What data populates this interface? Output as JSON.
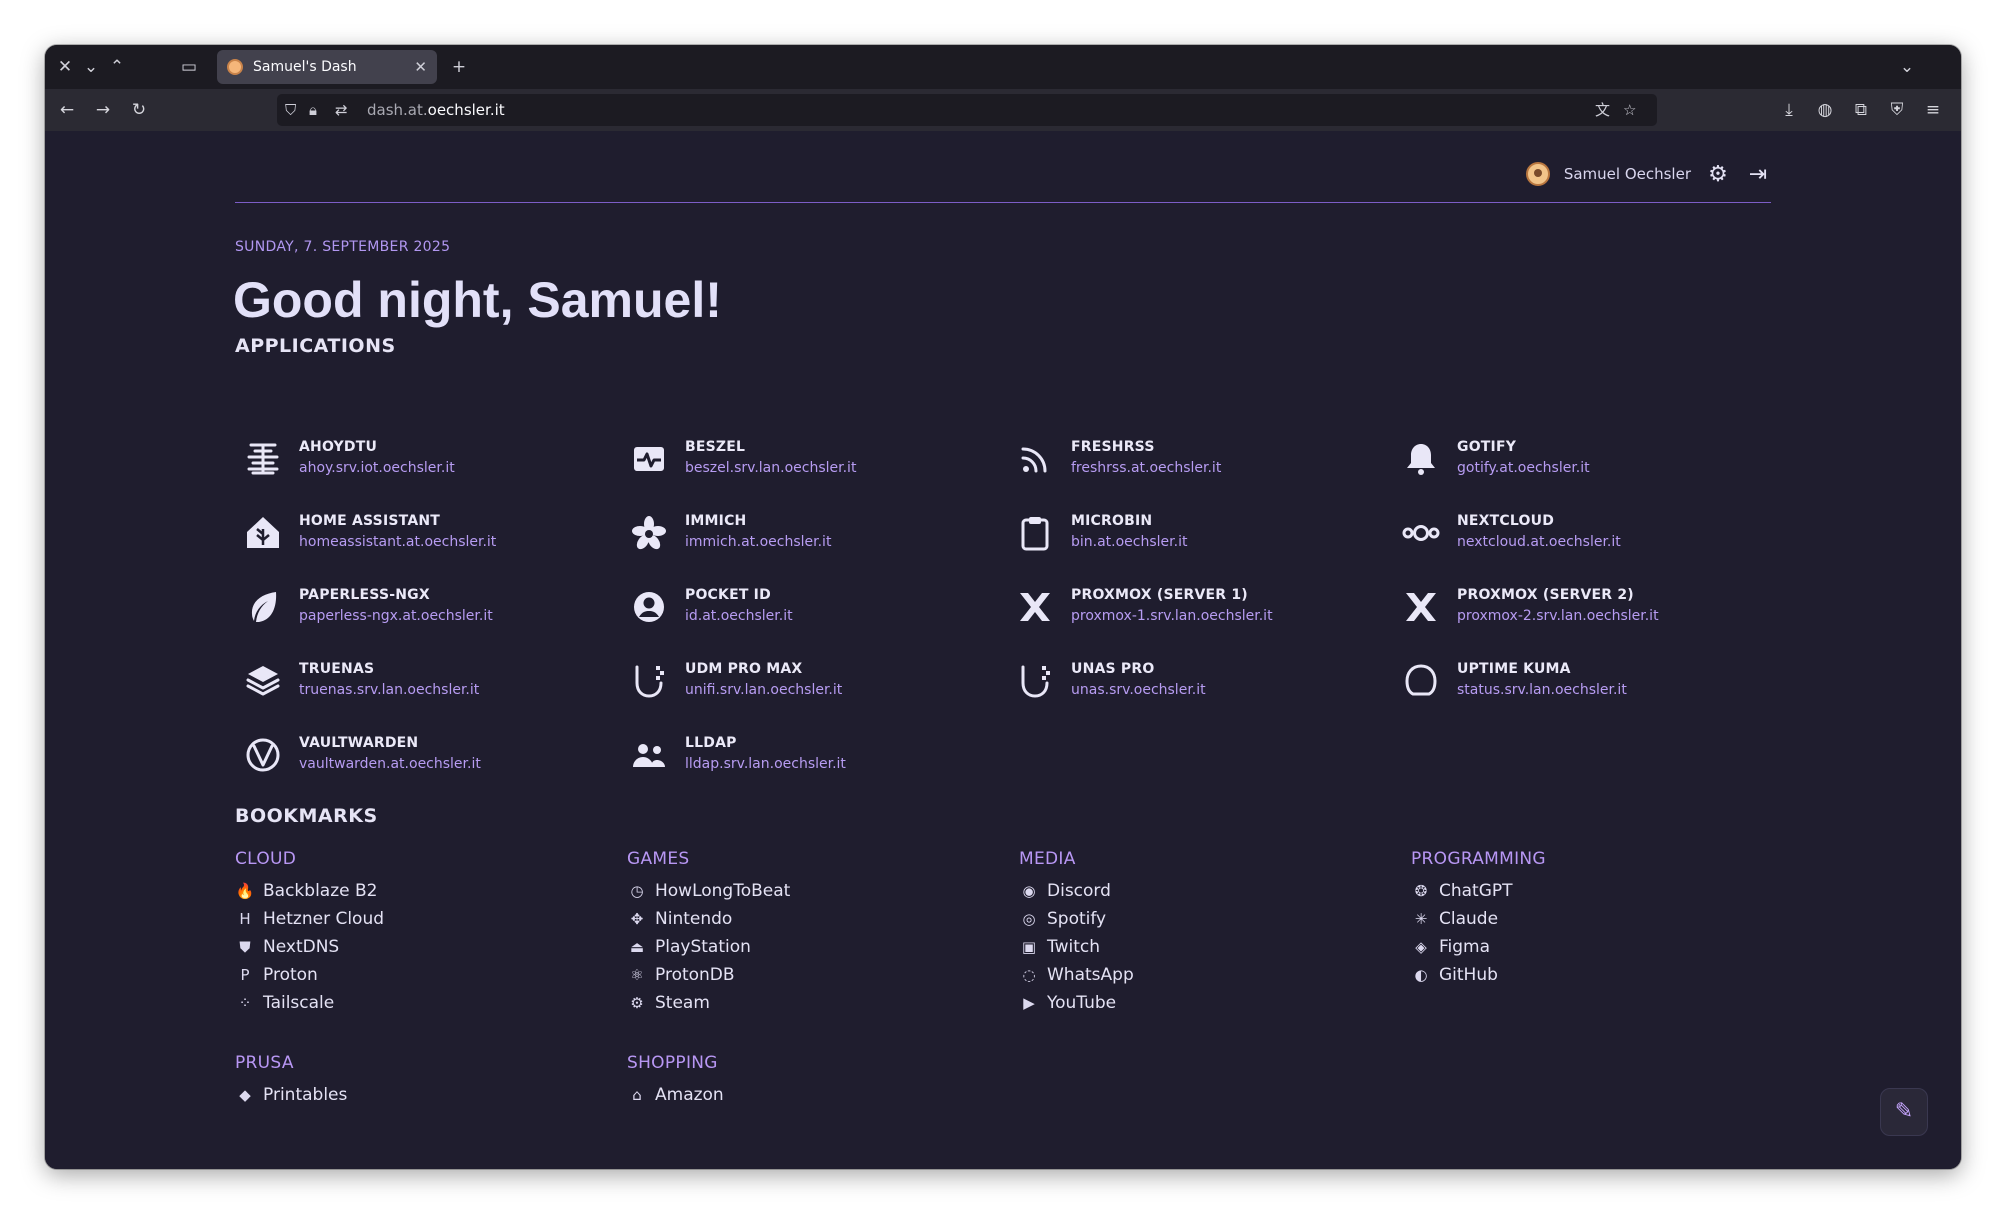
{
  "browser": {
    "tab_title": "Samuel's Dash",
    "new_tab": "+",
    "url_domain_prefix": "dash.at.",
    "url_domain_main": "oechsler.it"
  },
  "header": {
    "user_name": "Samuel Oechsler"
  },
  "greeting": {
    "date": "SUNDAY, 7. SEPTEMBER 2025",
    "title": "Good night, Samuel!"
  },
  "sections": {
    "applications": "APPLICATIONS",
    "bookmarks": "BOOKMARKS"
  },
  "applications": [
    {
      "name": "AHOYDTU",
      "url": "ahoy.srv.iot.oechsler.it",
      "icon": "ahoydtu-icon"
    },
    {
      "name": "BESZEL",
      "url": "beszel.srv.lan.oechsler.it",
      "icon": "beszel-icon"
    },
    {
      "name": "FRESHRSS",
      "url": "freshrss.at.oechsler.it",
      "icon": "rss-icon"
    },
    {
      "name": "GOTIFY",
      "url": "gotify.at.oechsler.it",
      "icon": "bell-icon"
    },
    {
      "name": "HOME ASSISTANT",
      "url": "homeassistant.at.oechsler.it",
      "icon": "home-assistant-icon"
    },
    {
      "name": "IMMICH",
      "url": "immich.at.oechsler.it",
      "icon": "immich-icon"
    },
    {
      "name": "MICROBIN",
      "url": "bin.at.oechsler.it",
      "icon": "clipboard-icon"
    },
    {
      "name": "NEXTCLOUD",
      "url": "nextcloud.at.oechsler.it",
      "icon": "nextcloud-icon"
    },
    {
      "name": "PAPERLESS-NGX",
      "url": "paperless-ngx.at.oechsler.it",
      "icon": "leaf-icon"
    },
    {
      "name": "POCKET ID",
      "url": "id.at.oechsler.it",
      "icon": "user-circle-icon"
    },
    {
      "name": "PROXMOX (SERVER 1)",
      "url": "proxmox-1.srv.lan.oechsler.it",
      "icon": "proxmox-icon"
    },
    {
      "name": "PROXMOX (SERVER 2)",
      "url": "proxmox-2.srv.lan.oechsler.it",
      "icon": "proxmox-icon"
    },
    {
      "name": "TRUENAS",
      "url": "truenas.srv.lan.oechsler.it",
      "icon": "truenas-icon"
    },
    {
      "name": "UDM PRO MAX",
      "url": "unifi.srv.lan.oechsler.it",
      "icon": "unifi-icon"
    },
    {
      "name": "UNAS PRO",
      "url": "unas.srv.oechsler.it",
      "icon": "unifi-icon"
    },
    {
      "name": "UPTIME KUMA",
      "url": "status.srv.lan.oechsler.it",
      "icon": "uptime-kuma-icon"
    },
    {
      "name": "VAULTWARDEN",
      "url": "vaultwarden.at.oechsler.it",
      "icon": "vaultwarden-icon"
    },
    {
      "name": "LLDAP",
      "url": "lldap.srv.lan.oechsler.it",
      "icon": "users-icon"
    }
  ],
  "bookmarks": [
    {
      "title": "CLOUD",
      "items": [
        {
          "label": "Backblaze B2",
          "icon": "flame-icon",
          "glyph": "🔥"
        },
        {
          "label": "Hetzner Cloud",
          "icon": "hetzner-icon",
          "glyph": "H"
        },
        {
          "label": "NextDNS",
          "icon": "shield-icon",
          "glyph": "⛊"
        },
        {
          "label": "Proton",
          "icon": "proton-icon",
          "glyph": "P"
        },
        {
          "label": "Tailscale",
          "icon": "tailscale-icon",
          "glyph": "⁘"
        }
      ]
    },
    {
      "title": "GAMES",
      "items": [
        {
          "label": "HowLongToBeat",
          "icon": "clock-icon",
          "glyph": "◷"
        },
        {
          "label": "Nintendo",
          "icon": "nintendo-icon",
          "glyph": "✥"
        },
        {
          "label": "PlayStation",
          "icon": "playstation-icon",
          "glyph": "⏏"
        },
        {
          "label": "ProtonDB",
          "icon": "protondb-icon",
          "glyph": "⚛"
        },
        {
          "label": "Steam",
          "icon": "steam-icon",
          "glyph": "⚙"
        }
      ]
    },
    {
      "title": "MEDIA",
      "items": [
        {
          "label": "Discord",
          "icon": "discord-icon",
          "glyph": "◉"
        },
        {
          "label": "Spotify",
          "icon": "spotify-icon",
          "glyph": "◎"
        },
        {
          "label": "Twitch",
          "icon": "twitch-icon",
          "glyph": "▣"
        },
        {
          "label": "WhatsApp",
          "icon": "whatsapp-icon",
          "glyph": "◌"
        },
        {
          "label": "YouTube",
          "icon": "youtube-icon",
          "glyph": "▶"
        }
      ]
    },
    {
      "title": "PROGRAMMING",
      "items": [
        {
          "label": "ChatGPT",
          "icon": "chatgpt-icon",
          "glyph": "❂"
        },
        {
          "label": "Claude",
          "icon": "claude-icon",
          "glyph": "✳"
        },
        {
          "label": "Figma",
          "icon": "figma-icon",
          "glyph": "◈"
        },
        {
          "label": "GitHub",
          "icon": "github-icon",
          "glyph": "◐"
        }
      ]
    },
    {
      "title": "PRUSA",
      "items": [
        {
          "label": "Printables",
          "icon": "printables-icon",
          "glyph": "◆"
        }
      ]
    },
    {
      "title": "SHOPPING",
      "items": [
        {
          "label": "Amazon",
          "icon": "basket-icon",
          "glyph": "⌂"
        }
      ]
    }
  ],
  "colors": {
    "background": "#1f1d2e",
    "accent": "#b79cf2",
    "divider": "#7c5dc7"
  }
}
